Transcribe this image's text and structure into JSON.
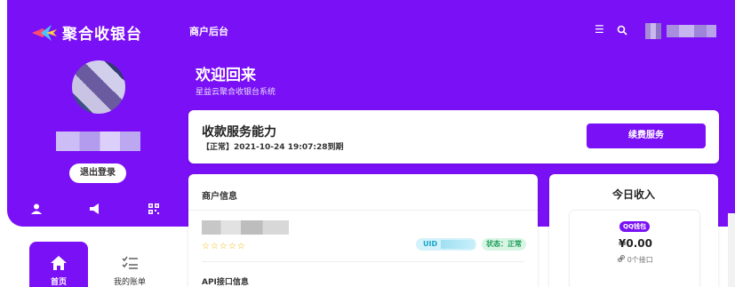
{
  "app": {
    "name": "聚合收银台"
  },
  "header": {
    "breadcrumb": "商户后台",
    "menu_icon": "menu-icon",
    "search_icon": "search-icon"
  },
  "profile": {
    "logout_label": "退出登录",
    "icons": [
      "user-icon",
      "megaphone-icon",
      "qrcode-icon"
    ]
  },
  "welcome": {
    "title": "欢迎回来",
    "subtitle": "星益云聚合收银台系统"
  },
  "service": {
    "title": "收款服务能力",
    "status_text": "【正常】2021-10-24 19:07:28到期",
    "renew_label": "续费服务"
  },
  "merchant": {
    "title": "商户信息",
    "rating": "☆☆☆☆☆",
    "uid_label": "UID",
    "status_label": "状态：正常",
    "api_title": "API接口信息"
  },
  "today": {
    "title": "今日收入",
    "badge": "QQ钱包",
    "amount": "¥0.00",
    "interfaces": "0个接口"
  },
  "nav": {
    "home_label": "首页",
    "bill_label": "我的账单"
  },
  "colors": {
    "primary": "#7a10f5",
    "uid_bg": "#d4f2fb",
    "status_bg": "#d8f5e4"
  }
}
